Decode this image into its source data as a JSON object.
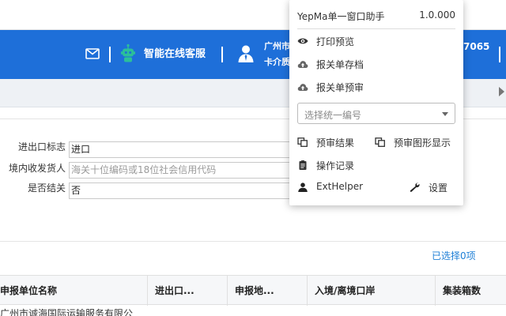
{
  "header": {
    "service_label": "智能在线客服",
    "city_label": "广州市",
    "card_label": "卡介质",
    "phone_fragment": "7065"
  },
  "form": {
    "fields": [
      {
        "label": "进出口标志",
        "value": "进口",
        "placeholder": ""
      },
      {
        "label": "境内收发货人",
        "value": "",
        "placeholder": "海关十位编码或18位社会信用代码"
      },
      {
        "label": "是否结关",
        "value": "否",
        "placeholder": ""
      }
    ]
  },
  "selection": {
    "count_text": "已选择0项"
  },
  "table": {
    "columns": [
      "申报单位名称",
      "进出口...",
      "申报地...",
      "入境/离境口岸",
      "集装箱数"
    ],
    "first_row_fragment": "广州市诚海国际运输服务有限公"
  },
  "popup": {
    "title": "YepMa单一窗口助手",
    "version": "1.0.000",
    "items": {
      "print_preview": "打印预览",
      "archive": "报关单存档",
      "precheck": "报关单预审",
      "precheck_result": "预审结果",
      "precheck_graph": "预审图形显示",
      "operation_log": "操作记录",
      "exthelper": "ExtHelper",
      "settings": "设置"
    },
    "select_placeholder": "选择统一编号"
  },
  "colors": {
    "brand_blue": "#1e6fd9",
    "link_blue": "#1e7fd6",
    "robot_green": "#2bbf9a"
  }
}
